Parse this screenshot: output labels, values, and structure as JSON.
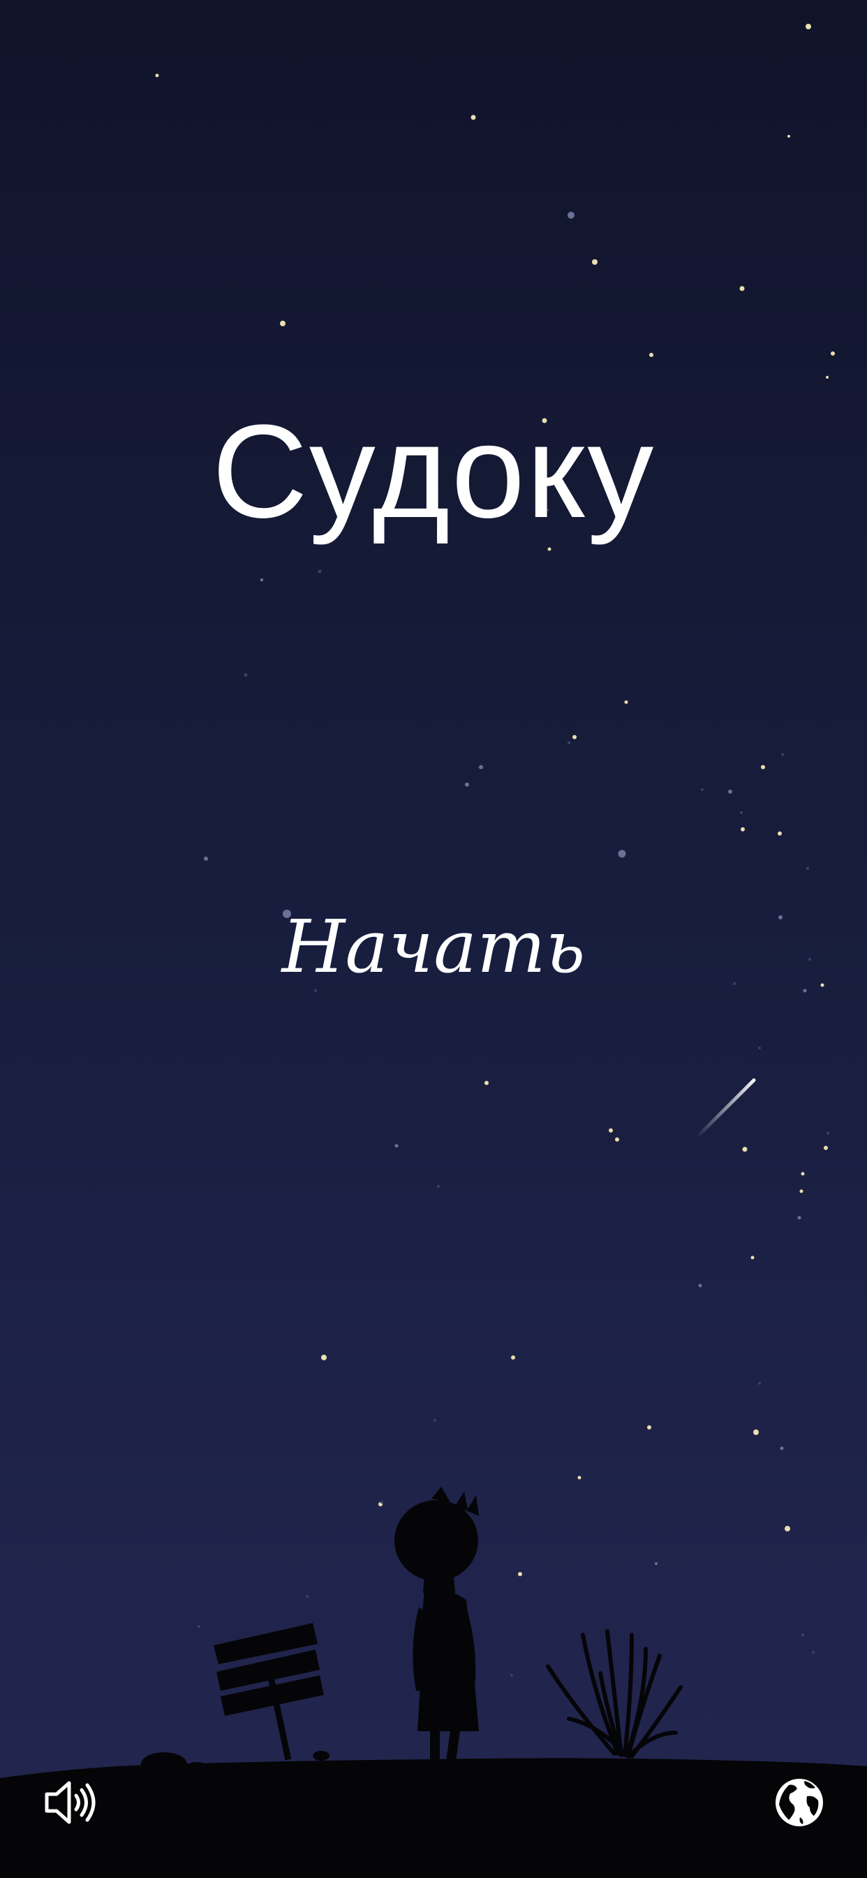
{
  "game": {
    "title": "Судоку",
    "start_label": "Начать"
  },
  "controls": {
    "sound_icon": "speaker-volume-icon",
    "language_icon": "globe-icon"
  },
  "colors": {
    "sky_top": "#10132a",
    "sky_bottom": "#23274f",
    "ground": "#050508",
    "text": "#ffffff",
    "star_warm": "#e9dfae"
  }
}
